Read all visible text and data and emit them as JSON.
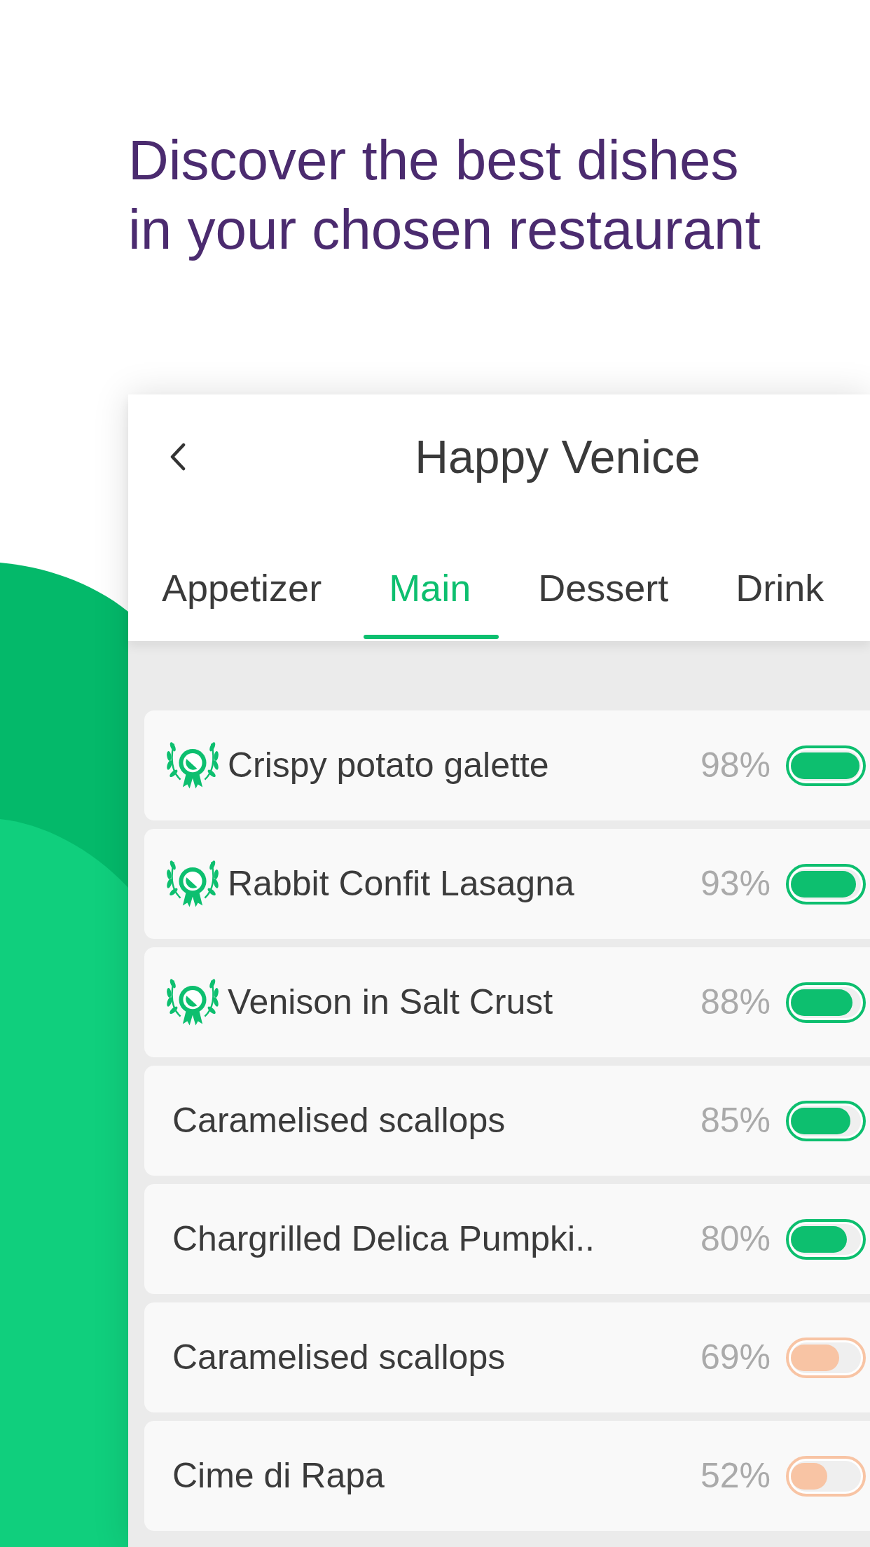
{
  "headline": "Discover the best dishes in your chosen restaurant",
  "restaurant": {
    "title": "Happy Venice"
  },
  "tabs": [
    {
      "label": "Appetizer",
      "selected": false
    },
    {
      "label": "Main",
      "selected": true
    },
    {
      "label": "Dessert",
      "selected": false
    },
    {
      "label": "Drink",
      "selected": false
    }
  ],
  "dishes": [
    {
      "name": "Crispy potato galette",
      "award": true,
      "percent": "98%",
      "level": 0.98,
      "color": "#0dbf6f"
    },
    {
      "name": "Rabbit Confit Lasagna",
      "award": true,
      "percent": "93%",
      "level": 0.93,
      "color": "#0dbf6f"
    },
    {
      "name": "Venison in Salt Crust",
      "award": true,
      "percent": "88%",
      "level": 0.88,
      "color": "#0dbf6f"
    },
    {
      "name": "Caramelised scallops",
      "award": false,
      "percent": "85%",
      "level": 0.85,
      "color": "#0dbf6f"
    },
    {
      "name": "Chargrilled Delica Pumpki..",
      "award": false,
      "percent": "80%",
      "level": 0.8,
      "color": "#0dbf6f"
    },
    {
      "name": "Caramelised scallops",
      "award": false,
      "percent": "69%",
      "level": 0.69,
      "color": "#f8c4a4"
    },
    {
      "name": "Cime di Rapa",
      "award": false,
      "percent": "52%",
      "level": 0.52,
      "color": "#f8c4a4"
    }
  ]
}
